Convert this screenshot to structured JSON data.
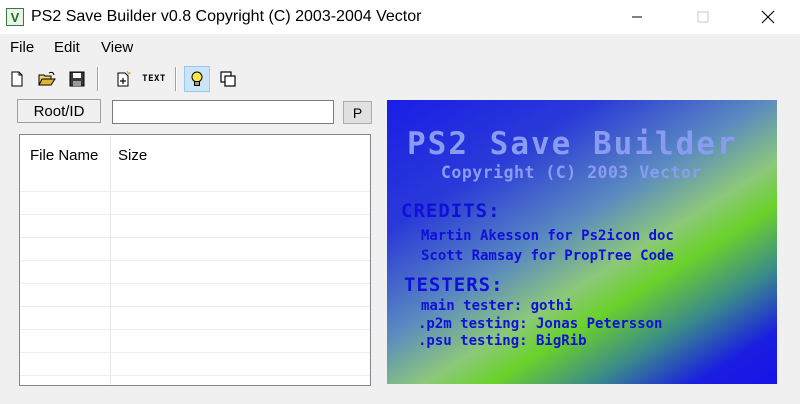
{
  "window": {
    "title": "PS2 Save Builder v0.8 Copyright (C) 2003-2004 Vector",
    "icon_letter": "V"
  },
  "menu": {
    "items": [
      {
        "label": "File"
      },
      {
        "label": "Edit"
      },
      {
        "label": "View"
      }
    ]
  },
  "toolbar": {
    "new": "new-file-icon",
    "open": "open-folder-icon",
    "save": "save-disk-icon",
    "new_item": "new-item-icon",
    "text_label": "TEXT",
    "hint": "lightbulb-icon",
    "copy": "copy-icon"
  },
  "root": {
    "label": "Root/ID",
    "value": "",
    "button_label": "P"
  },
  "filelist": {
    "columns": [
      "File Name",
      "Size"
    ],
    "rows": []
  },
  "splash": {
    "title": "PS2 Save Builder",
    "copyright": "Copyright (C) 2003 Vector",
    "credits_heading": "CREDITS:",
    "credits": [
      "Martin Akesson for Ps2icon doc",
      "Scott Ramsay for PropTree Code"
    ],
    "testers_heading": "TESTERS:",
    "testers": [
      "main tester: gothi",
      ".p2m testing: Jonas Petersson",
      ".psu testing: BigRib"
    ]
  },
  "colors": {
    "splash_text_dark": "#1010d8",
    "splash_text_light": "#8a9cf2",
    "active_tool": "#cce4f7"
  }
}
